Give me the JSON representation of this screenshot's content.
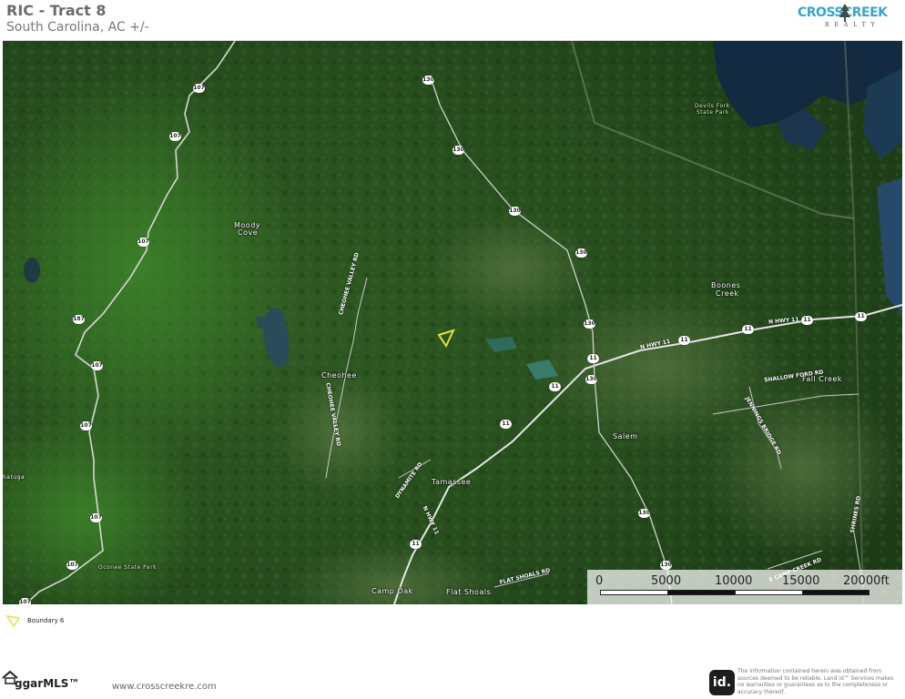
{
  "header": {
    "title": "RIC - Tract 8",
    "subtitle": "South Carolina,  AC +/-"
  },
  "brand": {
    "name_line1": "CROSSCREEK",
    "name_line2": "REALTY",
    "accent_color": "#3aa4c9"
  },
  "map": {
    "places": [
      {
        "id": "moody-cove-1",
        "text": "Moody"
      },
      {
        "id": "moody-cove-2",
        "text": "Cove"
      },
      {
        "id": "cheohee",
        "text": "Cheohee"
      },
      {
        "id": "boones-1",
        "text": "Boones"
      },
      {
        "id": "boones-2",
        "text": "Creek"
      },
      {
        "id": "fall-creek",
        "text": "Fall Creek"
      },
      {
        "id": "salem",
        "text": "Salem"
      },
      {
        "id": "tamassee",
        "text": "Tamassee"
      },
      {
        "id": "camp-oak",
        "text": "Camp Oak"
      },
      {
        "id": "flat-shoals",
        "text": "Flat Shoals"
      },
      {
        "id": "devils-fork-1",
        "text": "Devils Fork"
      },
      {
        "id": "devils-fork-2",
        "text": "State Park"
      },
      {
        "id": "oconee-sp",
        "text": "Oconee State Park"
      },
      {
        "id": "chatuga",
        "text": "hatuga"
      }
    ],
    "roads": [
      {
        "id": "cheohee-valley-1",
        "text": "CHEOHEE VALLEY RD"
      },
      {
        "id": "cheohee-valley-2",
        "text": "CHEOHEE VALLEY RD"
      },
      {
        "id": "n-hwy-11-a",
        "text": "N HWY 11"
      },
      {
        "id": "n-hwy-11-b",
        "text": "N HWY 11"
      },
      {
        "id": "n-hwy-11-c",
        "text": "N HWY 11"
      },
      {
        "id": "shallow-ford",
        "text": "SHALLOW FORD RD"
      },
      {
        "id": "dynamite",
        "text": "DYNAMITE RD"
      },
      {
        "id": "flat-shoals-rd",
        "text": "FLAT SHOALS RD"
      },
      {
        "id": "e-camp-creek",
        "text": "E CAMP CREEK RD"
      },
      {
        "id": "jennings",
        "text": "JENNINGS BRIDGE RD"
      },
      {
        "id": "shrines",
        "text": "SHRINES RD"
      }
    ],
    "shields": [
      "107",
      "107",
      "107",
      "187",
      "107",
      "107",
      "107",
      "107",
      "107",
      "130",
      "130",
      "130",
      "130",
      "130",
      "130",
      "130",
      "130",
      "11",
      "11",
      "11",
      "11",
      "11",
      "11",
      "11",
      "11"
    ],
    "boundary_color": "#e8e03a"
  },
  "scale": {
    "labels": [
      "0",
      "5000",
      "10000",
      "15000",
      "20000ft"
    ]
  },
  "legend": {
    "label": "Boundary 6"
  },
  "footer": {
    "mls": "ggarMLS™",
    "website": "www.crosscreekre.com",
    "id_badge": "id.",
    "disclaimer": "The information contained herein was obtained from sources deemed to be reliable. Land id™ Services makes no warranties or guarantees as to the completeness or accuracy thereof."
  }
}
